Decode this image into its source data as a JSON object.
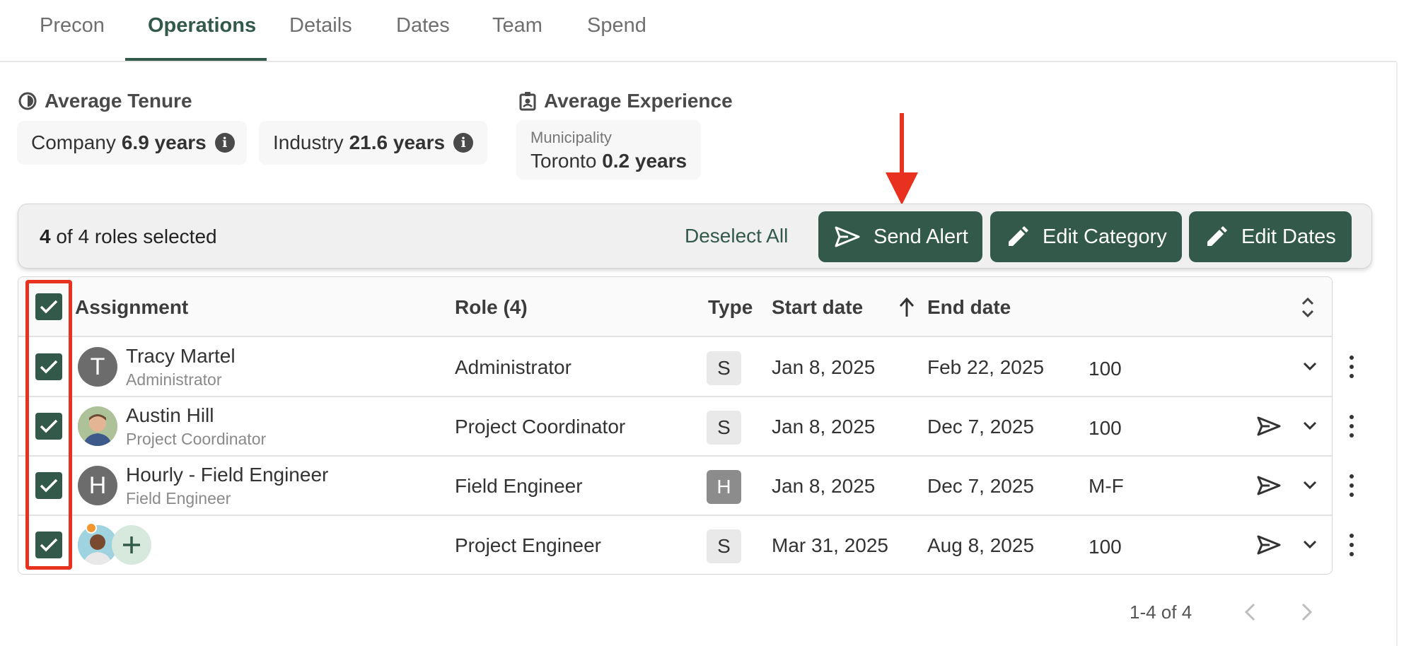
{
  "tabs": [
    {
      "label": "Precon"
    },
    {
      "label": "Operations"
    },
    {
      "label": "Details"
    },
    {
      "label": "Dates"
    },
    {
      "label": "Team"
    },
    {
      "label": "Spend"
    }
  ],
  "active_tab": "Operations",
  "tenure": {
    "title": "Average Tenure",
    "company_label": "Company",
    "company_value": "6.9 years",
    "industry_label": "Industry",
    "industry_value": "21.6 years"
  },
  "experience": {
    "title": "Average Experience",
    "municipality_label": "Municipality",
    "city": "Toronto",
    "value": "0.2 years"
  },
  "selection": {
    "count": "4",
    "rest": "of 4 roles selected",
    "deselect_label": "Deselect All",
    "send_alert_label": "Send Alert",
    "edit_category_label": "Edit Category",
    "edit_dates_label": "Edit Dates"
  },
  "table": {
    "headers": {
      "assignment": "Assignment",
      "role": "Role (4)",
      "type": "Type",
      "start": "Start date",
      "end": "End date"
    },
    "rows": [
      {
        "name": "Tracy Martel",
        "subtitle": "Administrator",
        "avatar": "T",
        "role": "Administrator",
        "type": "S",
        "start": "Jan 8, 2025",
        "end": "Feb 22, 2025",
        "allocation": "100",
        "checked": true
      },
      {
        "name": "Austin Hill",
        "subtitle": "Project Coordinator",
        "avatar": "",
        "role": "Project Coordinator",
        "type": "S",
        "start": "Jan 8, 2025",
        "end": "Dec 7, 2025",
        "allocation": "100",
        "checked": true
      },
      {
        "name": "Hourly - Field Engineer",
        "subtitle": "Field Engineer",
        "avatar": "H",
        "role": "Field Engineer",
        "type": "H",
        "start": "Jan 8, 2025",
        "end": "Dec 7, 2025",
        "allocation": "M-F",
        "checked": true
      },
      {
        "name": "",
        "subtitle": "",
        "avatar": "",
        "role": "Project Engineer",
        "type": "S",
        "start": "Mar 31, 2025",
        "end": "Aug 8, 2025",
        "allocation": "100",
        "checked": true
      }
    ]
  },
  "pagination": {
    "range": "1-4 of 4"
  },
  "colors": {
    "brand": "#32594a",
    "annotation": "#e8321f"
  }
}
